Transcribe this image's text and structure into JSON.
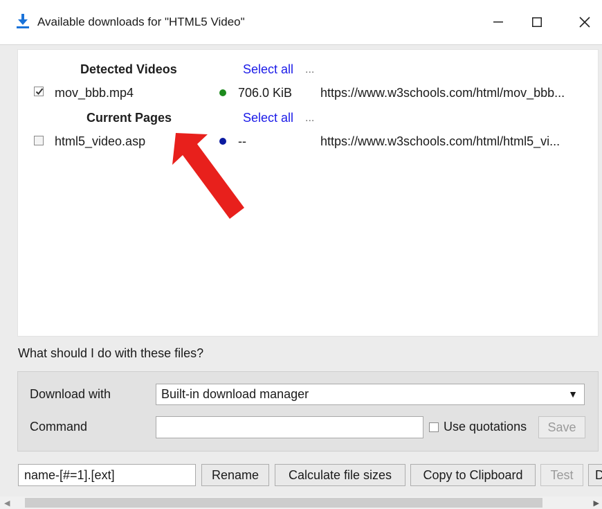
{
  "window": {
    "title": "Available downloads for \"HTML5 Video\"",
    "icon": "download-arrow-icon",
    "accent": "#1a73d9"
  },
  "sections": [
    {
      "title": "Detected Videos",
      "select_all": "Select all",
      "more": "...",
      "items": [
        {
          "checked": true,
          "name": "mov_bbb.mp4",
          "status_color": "#1d8a1d",
          "size": "706.0 KiB",
          "url": "https://www.w3schools.com/html/mov_bbb..."
        }
      ]
    },
    {
      "title": "Current Pages",
      "select_all": "Select all",
      "more": "...",
      "items": [
        {
          "checked": false,
          "name": "html5_video.asp",
          "status_color": "#0a1aa0",
          "size": "--",
          "url": "https://www.w3schools.com/html/html5_vi..."
        }
      ]
    }
  ],
  "annotation": {
    "icon": "red-pointer-arrow-icon",
    "color": "#e8201c"
  },
  "question": "What should I do with these files?",
  "options": {
    "download_with_label": "Download with",
    "download_with_value": "Built-in download manager",
    "command_label": "Command",
    "command_value": "",
    "use_quotations_label": "Use quotations",
    "use_quotations_checked": false,
    "save_label": "Save"
  },
  "bottom": {
    "rename_pattern": "name-[#=1].[ext]",
    "rename_label": "Rename",
    "calc_sizes_label": "Calculate file sizes",
    "copy_label": "Copy to Clipboard",
    "test_label": "Test",
    "cut_off_label": "D"
  }
}
